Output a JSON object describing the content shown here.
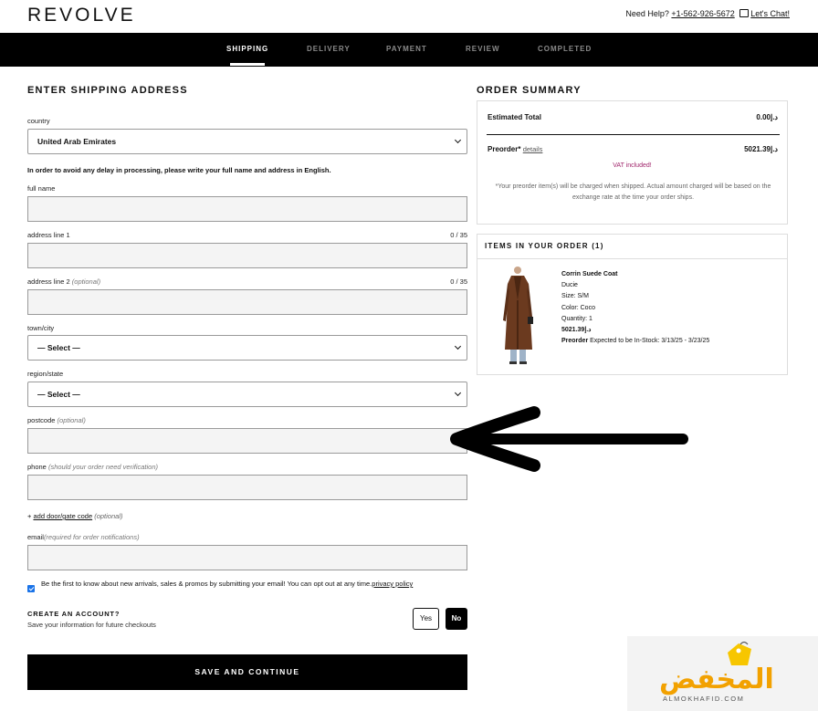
{
  "header": {
    "logo": "REVOLVE",
    "help_label": "Need Help?",
    "phone": "+1-562-926-5672",
    "chat_label": "Let's Chat!"
  },
  "steps": [
    "SHIPPING",
    "DELIVERY",
    "PAYMENT",
    "REVIEW",
    "COMPLETED"
  ],
  "active_step": "SHIPPING",
  "form": {
    "title": "ENTER SHIPPING ADDRESS",
    "country_label": "country",
    "country_value": "United Arab Emirates",
    "notice": "In order to avoid any delay in processing, please write your full name and address in English.",
    "full_name_label": "full name",
    "address1_label": "address line 1",
    "address1_counter": "0 / 35",
    "address2_label": "address line 2",
    "address2_optional": "(optional)",
    "address2_counter": "0 / 35",
    "city_label": "town/city",
    "city_value": "— Select —",
    "region_label": "region/state",
    "region_value": "— Select —",
    "postcode_label": "postcode",
    "postcode_optional": "(optional)",
    "phone_label": "phone",
    "phone_hint": "(should your order need verification)",
    "doorcode_plus": "+",
    "doorcode_link": "add door/gate code",
    "doorcode_optional": "(optional)",
    "email_label": "email",
    "email_hint": "(required for order notifications)",
    "optin_text": "Be the first to know about new arrivals, sales & promos by submitting your email! You can opt out at any time.",
    "optin_link": "privacy policy",
    "optin_checked": true,
    "account_title": "CREATE AN ACCOUNT?",
    "account_sub": "Save your information for future checkouts",
    "yes_label": "Yes",
    "no_label": "No",
    "save_label": "SAVE AND CONTINUE"
  },
  "summary": {
    "title": "ORDER SUMMARY",
    "estimated_label": "Estimated Total",
    "estimated_value": "د.إ0.00",
    "preorder_label": "Preorder*",
    "details_label": "details",
    "preorder_value": "د.إ5021.39",
    "vat": "VAT included!",
    "note": "*Your preorder item(s) will be charged when shipped. Actual amount charged will be based on the exchange rate at the time your order ships.",
    "vat_color": "#a0256b"
  },
  "items": {
    "title": "ITEMS IN YOUR ORDER (1)",
    "product": {
      "name": "Corrin Suede Coat",
      "brand": "Ducie",
      "size": "Size:  S/M",
      "color": "Color:  Coco",
      "quantity": "Quantity:  1",
      "price": "د.إ5021.39",
      "preorder_label": "Preorder",
      "preorder_text": "Expected to be In-Stock: 3/13/25 - 3/23/25"
    }
  },
  "watermark": {
    "text": "المخفض",
    "sub": "ALMOKHAFID.COM"
  }
}
